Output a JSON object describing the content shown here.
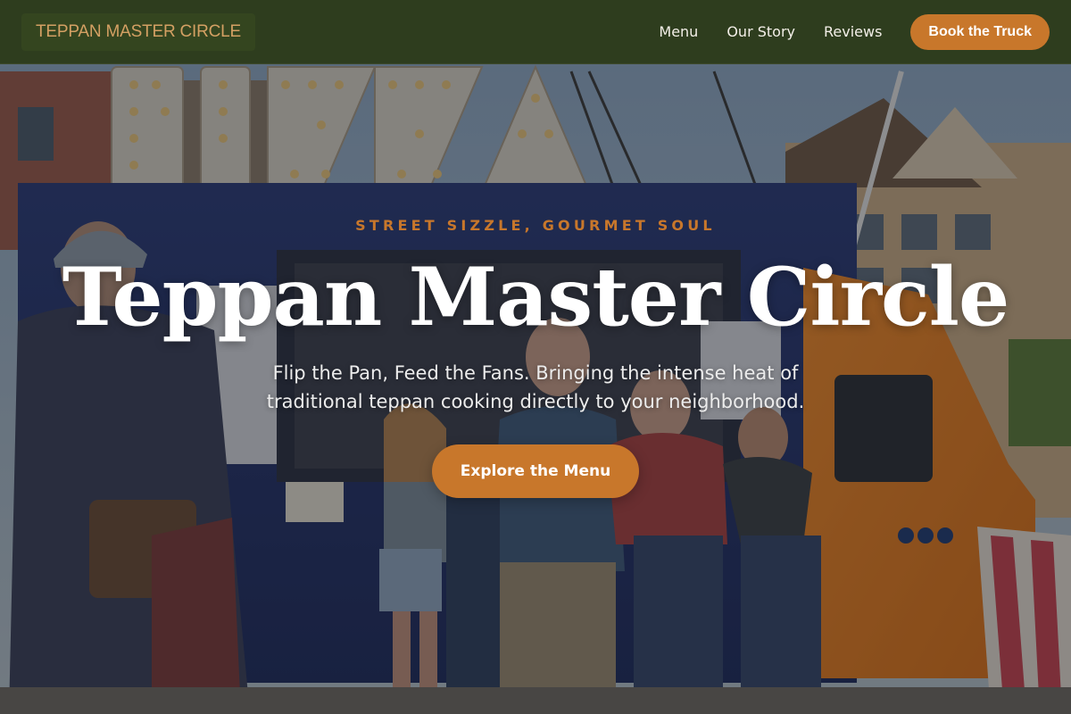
{
  "nav": {
    "brand": "TEPPAN MASTER CIRCLE",
    "links": [
      "Menu",
      "Our Story",
      "Reviews"
    ],
    "cta": "Book the Truck"
  },
  "hero": {
    "tagline": "STREET SIZZLE, GOURMET SOUL",
    "title": "Teppan Master Circle",
    "subtitle": "Flip the Pan, Feed the Fans. Bringing the intense heat of traditional teppan cooking directly to your neighborhood.",
    "cta": "Explore the Menu",
    "background_image": "food truck scene with crowd"
  },
  "colors": {
    "nav_bg": "#2e3d1e",
    "brand_text": "#d4a063",
    "accent": "#c8772b",
    "title": "#ffffff"
  }
}
